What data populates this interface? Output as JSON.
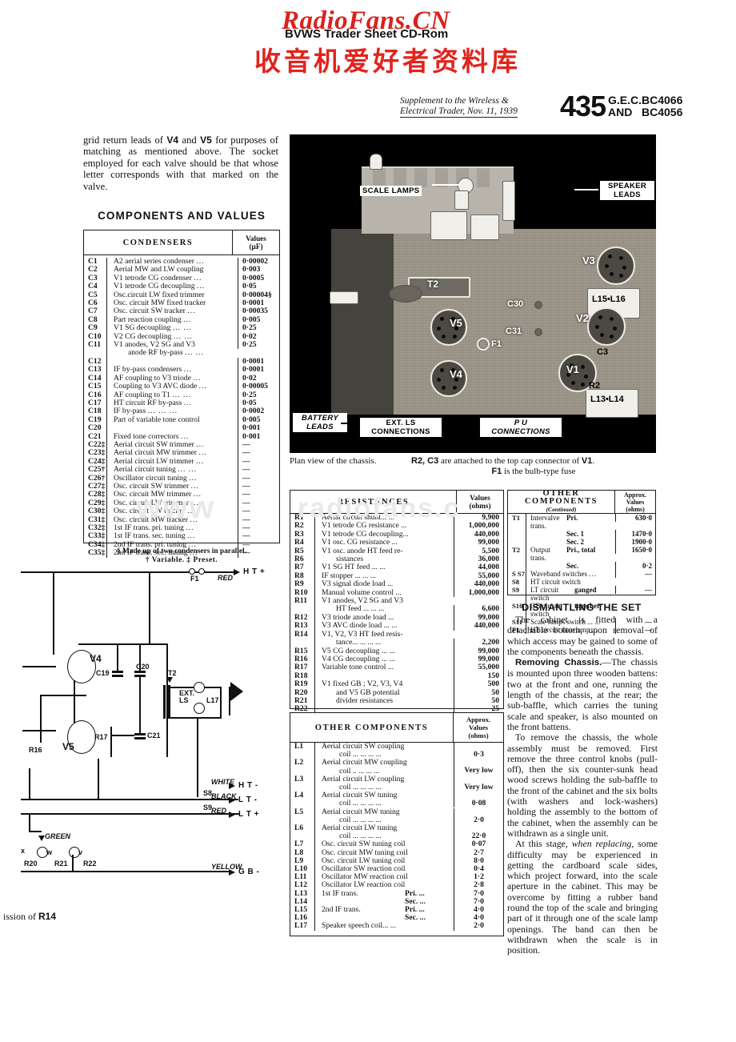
{
  "watermark": {
    "title": "RadioFans.CN",
    "subtitle": "BVWS Trader Sheet CD-Rom",
    "chinese": "收音机爱好者资料库",
    "faint_left": "www",
    "faint_mid": "radiofans.c",
    "accent": "#d8231e"
  },
  "masthead": {
    "supplement_line1": "Supplement to the Wireless &",
    "supplement_line2": "Electrical Trader, Nov. 11, 1939",
    "sheet_number": "435",
    "maker": "G.E.C.",
    "model_1": "BC4066",
    "and": "AND",
    "model_2": "BC4056"
  },
  "intro": {
    "paragraph": "grid return leads of <b>V4</b> and <b>V5</b> for purposes of matching as mentioned above. The socket employed for each valve should be that whose letter corresponds with that marked on the valve.",
    "section_title": "COMPONENTS AND VALUES"
  },
  "condensers": {
    "header": "CONDENSERS",
    "value_header_line1": "Values",
    "value_header_line2": "(µF)",
    "rows": [
      {
        "ref": "C1",
        "desc": "A2 aerial series condenser",
        "dots": "...",
        "val": "0·00002"
      },
      {
        "ref": "C2",
        "desc": "Aerial MW and LW coupling",
        "dots": "",
        "val": "0·003"
      },
      {
        "ref": "C3",
        "desc": "V1 tetrode CG condenser",
        "dots": "...",
        "val": "0·0005"
      },
      {
        "ref": "C4",
        "desc": "V1 tetrode CG decoupling",
        "dots": "...",
        "val": "0·05"
      },
      {
        "ref": "C5",
        "desc": "Osc.circuit LW fixed trimmer",
        "dots": "",
        "val": "0·00004§"
      },
      {
        "ref": "C6",
        "desc": "Osc. circuit MW fixed tracker",
        "dots": "",
        "val": "0·0001"
      },
      {
        "ref": "C7",
        "desc": "Osc. circuit SW tracker",
        "dots": "...",
        "val": "0·00035"
      },
      {
        "ref": "C8",
        "desc": "Part reaction coupling",
        "dots": "...",
        "val": "0·005"
      },
      {
        "ref": "C9",
        "desc": "V1 SG decoupling",
        "dots": "...   ...",
        "val": "0·25"
      },
      {
        "ref": "C10",
        "desc": "V2 CG decoupling",
        "dots": "...   ...",
        "val": "0·02"
      },
      {
        "ref": "C11",
        "desc": "V1 anodes, V2 SG and V3",
        "dots": "",
        "val": "0·25"
      },
      {
        "ref": "",
        "desc": "anode RF by-pass",
        "dots": "...   ...",
        "val": "",
        "cont": true,
        "indent": true
      },
      {
        "ref": "C12",
        "desc": "",
        "dots": "",
        "val": "0·0001"
      },
      {
        "ref": "C13",
        "desc": "IF by-pass condensers",
        "dots": "...",
        "val": "0·0001",
        "brace": true
      },
      {
        "ref": "C14",
        "desc": "AF coupling to V3 triode",
        "dots": "...",
        "val": "0·02"
      },
      {
        "ref": "C15",
        "desc": "Coupling to V3 AVC diode",
        "dots": "...",
        "val": "0·00005"
      },
      {
        "ref": "C16",
        "desc": "AF coupling to T1",
        "dots": "...   ...",
        "val": "0·25"
      },
      {
        "ref": "C17",
        "desc": "HT circuit RF by-pass",
        "dots": "...",
        "val": "0·05"
      },
      {
        "ref": "C18",
        "desc": "IF by-pass",
        "dots": "...    ...    ...",
        "val": "0·0002"
      },
      {
        "ref": "C19",
        "desc": "Part of variable tone control",
        "dots": "",
        "val": "0·005"
      },
      {
        "ref": "C20",
        "desc": "",
        "dots": "",
        "val": "0·001"
      },
      {
        "ref": "C21",
        "desc": "Fixed tone correctors",
        "dots": "...",
        "val": "0·001",
        "brace": true
      },
      {
        "ref": "C22‡",
        "desc": "Aerial circuit SW trimmer",
        "dots": "...",
        "val": "—"
      },
      {
        "ref": "C23‡",
        "desc": "Aerial circuit MW trimmer",
        "dots": "...",
        "val": "—"
      },
      {
        "ref": "C24‡",
        "desc": "Aerial circuit LW trimmer",
        "dots": "...",
        "val": "—"
      },
      {
        "ref": "C25†",
        "desc": "Aerial circuit tuning",
        "dots": "...   ...",
        "val": "—"
      },
      {
        "ref": "C26†",
        "desc": "Oscillator circuit tuning",
        "dots": "...",
        "val": "—"
      },
      {
        "ref": "C27‡",
        "desc": "Osc. circuit SW trimmer",
        "dots": "...",
        "val": "—"
      },
      {
        "ref": "C28‡",
        "desc": "Osc. circuit MW trimmer",
        "dots": "...",
        "val": "—"
      },
      {
        "ref": "C29‡",
        "desc": "Osc. circuit LW trimmer",
        "dots": "...",
        "val": "—"
      },
      {
        "ref": "C30‡",
        "desc": "Osc. circuit LW tracker",
        "dots": "...",
        "val": "—"
      },
      {
        "ref": "C31‡",
        "desc": "Osc. circuit MW tracker",
        "dots": "...",
        "val": "—"
      },
      {
        "ref": "C32‡",
        "desc": "1st IF trans. pri. tuning",
        "dots": "...",
        "val": "—"
      },
      {
        "ref": "C33‡",
        "desc": "1st IF trans. sec. tuning",
        "dots": "...",
        "val": "—"
      },
      {
        "ref": "C34‡",
        "desc": "2nd IF trans. pri. tuning",
        "dots": "...",
        "val": "—"
      },
      {
        "ref": "C35‡",
        "desc": "2nd IF trans. sec. tuning",
        "dots": "...",
        "val": "—"
      }
    ],
    "footnote_line1": "§ Made up of two condensers in parallel.",
    "footnote_line2": "† Variable.      ‡ Preset."
  },
  "resistances": {
    "header": "RESISTANCES",
    "value_header_line1": "Values",
    "value_header_line2": "(ohms)",
    "rows": [
      {
        "ref": "R1",
        "desc": "Aerial circuit shunt...      ...",
        "val": "9,900"
      },
      {
        "ref": "R2",
        "desc": "V1 tetrode CG resistance ...",
        "val": "1,000,000"
      },
      {
        "ref": "R3",
        "desc": "V1 tetrode CG decoupling...",
        "val": "440,000"
      },
      {
        "ref": "R4",
        "desc": "V1 osc. CG resistance      ...",
        "val": "99,000"
      },
      {
        "ref": "R5",
        "desc": "V1 osc. anode HT feed re-",
        "val": "5,500"
      },
      {
        "ref": "R6",
        "desc": "sistances",
        "val": "36,000",
        "indent": true,
        "brace": true
      },
      {
        "ref": "R7",
        "desc": "V1 SG HT feed      ...      ...",
        "val": "44,000"
      },
      {
        "ref": "R8",
        "desc": "IF stopper   ...     ...     ...",
        "val": "55,000"
      },
      {
        "ref": "R9",
        "desc": "V3 signal diode load       ...",
        "val": "440,000"
      },
      {
        "ref": "R10",
        "desc": "Manual volume control  ...",
        "val": "1,000,000"
      },
      {
        "ref": "R11",
        "desc": "V1 anodes, V2 SG and V3",
        "val": ""
      },
      {
        "ref": "",
        "desc": "HT feed   ...     ...     ...",
        "val": "6,600",
        "cont": true,
        "indent": true
      },
      {
        "ref": "R12",
        "desc": "V3 triode anode load       ...",
        "val": "99,000"
      },
      {
        "ref": "R13",
        "desc": "V3 AVC diode load ...      ...",
        "val": "440,000"
      },
      {
        "ref": "R14",
        "desc": "V1, V2, V3 HT feed resis-",
        "val": ""
      },
      {
        "ref": "",
        "desc": "tance...     ...      ...      ...",
        "val": "2,200",
        "cont": true,
        "indent": true
      },
      {
        "ref": "R15",
        "desc": "V5 CG decoupling   ...     ...",
        "val": "99,000"
      },
      {
        "ref": "R16",
        "desc": "V4 CG decoupling   ...     ...",
        "val": "99,000"
      },
      {
        "ref": "R17",
        "desc": "Variable tone control      ...",
        "val": "55,000"
      },
      {
        "ref": "R18",
        "desc": "",
        "val": "150"
      },
      {
        "ref": "R19",
        "desc": "V1 fixed GB ; V2, V3, V4",
        "val": "500"
      },
      {
        "ref": "R20",
        "desc": "and V5 GB potential",
        "val": "50",
        "indent": true
      },
      {
        "ref": "R21",
        "desc": "divider resistances",
        "val": "50",
        "indent": true
      },
      {
        "ref": "R22",
        "desc": "",
        "val": "25"
      }
    ]
  },
  "other_components": {
    "header": "OTHER COMPONENTS",
    "value_header_line1": "Approx.",
    "value_header_line2": "Values",
    "value_header_line3": "(ohms)",
    "rows": [
      {
        "ref": "L1",
        "desc": "Aerial circuit SW coupling",
        "desc2": "coil    ...      ...      ...      ...",
        "val": "0·3"
      },
      {
        "ref": "L2",
        "desc": "Aerial circuit MW coupling",
        "desc2": "coil   ..      ...      ...      ...",
        "val": "Very low"
      },
      {
        "ref": "L3",
        "desc": "Aerial circuit LW coupling",
        "desc2": "coil    ...      ...      ...      ...",
        "val": "Very low"
      },
      {
        "ref": "L4",
        "desc": "Aerial circuit  SW  tuning",
        "desc2": "coil    ...      ...      ...      ...",
        "val": "0·08"
      },
      {
        "ref": "L5",
        "desc": "Aerial  circuit  MW  tuning",
        "desc2": "coil    ...      ...      ...      ...",
        "val": "2·0"
      },
      {
        "ref": "L6",
        "desc": "Aerial  circuit  LW  tuning",
        "desc2": "coil    ...      ...      ...      ...",
        "val": "22·0"
      },
      {
        "ref": "L7",
        "desc": "Osc. circuit SW tuning coil",
        "val": "0·07"
      },
      {
        "ref": "L8",
        "desc": "Osc. circuit MW tuning coil",
        "val": "2·7"
      },
      {
        "ref": "L9",
        "desc": "Osc. circuit LW tuning coil",
        "val": "8·0"
      },
      {
        "ref": "L10",
        "desc": "Oscillator SW reaction coil",
        "val": "0·4"
      },
      {
        "ref": "L11",
        "desc": "Oscillator MW reaction coil",
        "val": "1·2"
      },
      {
        "ref": "L12",
        "desc": "Oscillator LW reaction coil",
        "val": "2·8"
      },
      {
        "ref": "L13",
        "desc": "1st IF trans.",
        "sub": "Pri.        ...",
        "val": "7·0",
        "grouped": true
      },
      {
        "ref": "L14",
        "desc": "",
        "sub": "Sec.       ...",
        "val": "7·0",
        "grouped": true
      },
      {
        "ref": "L15",
        "desc": "2nd IF trans.",
        "sub": "Pri.        ...",
        "val": "4·0",
        "grouped": true
      },
      {
        "ref": "L16",
        "desc": "",
        "sub": "Sec.       ...",
        "val": "4·0",
        "grouped": true
      },
      {
        "ref": "L17",
        "desc": "Speaker speech coil...      ...",
        "val": "2·0"
      }
    ]
  },
  "other_components_continued": {
    "header": "OTHER COMPONENTS",
    "header_sub": "(Continued)",
    "value_header_line1": "Approx.",
    "value_header_line2": "Values",
    "value_header_line3": "(ohms)",
    "rows": [
      {
        "ref": "T1",
        "desc": "Intervalve trans.",
        "sub": "Pri.",
        "val": "630·0"
      },
      {
        "ref": "",
        "desc": "",
        "sub": "Sec. 1",
        "val": "1470·0"
      },
      {
        "ref": "",
        "desc": "",
        "sub": "Sec. 2",
        "val": "1900·0"
      },
      {
        "ref": "T2",
        "desc": "Output trans.",
        "sub": "Pri., total",
        "val": "1650·0"
      },
      {
        "ref": "",
        "desc": "",
        "sub": "Sec.",
        "val": "0·2"
      },
      {
        "ref": "S  S7",
        "desc": "Waveband switches",
        "dots": "...",
        "val": "—"
      },
      {
        "ref": "S8",
        "desc": "HT circuit switch",
        "val": ""
      },
      {
        "ref": "S9",
        "desc": "LT circuit switch",
        "val": "—",
        "note": "ganged"
      },
      {
        "ref": "S10",
        "desc": "GB circuit switch",
        "val": "",
        "note": "together"
      },
      {
        "ref": "S11",
        "desc": "Scale lamps switch ...   ...",
        "val": "—"
      },
      {
        "ref": "F1",
        "desc": "HT circuit fuse lamp      ...",
        "val": "—"
      }
    ]
  },
  "photo": {
    "labels": {
      "scale_lamps": "SCALE LAMPS",
      "speaker_leads_l1": "SPEAKER",
      "speaker_leads_l2": "LEADS",
      "battery_leads_l1": "BATTERY",
      "battery_leads_l2": "LEADS",
      "ext_ls_l1": "EXT. LS",
      "ext_ls_l2": "CONNECTIONS",
      "pu_l1": "P U",
      "pu_l2": "CONNECTIONS"
    },
    "callouts": [
      "T2",
      "V3",
      "L15 • L16",
      "V5",
      "F1",
      "C30",
      "C31",
      "V2",
      "C3",
      "V4",
      "V1",
      "L13 • L14",
      "R2"
    ]
  },
  "caption": {
    "left": "Plan view of the chassis.",
    "right_line1": "<b>R2, C3</b> are attached to the top cap connector of <b>V1</b>.",
    "right_line2": "<b>F1</b> is the bulb-type fuse"
  },
  "dismantling": {
    "heading": "DISMANTLING THE SET",
    "p1": "The cabinet is fitted with a detachable bottom, upon removal of which access may be gained to some of the components beneath the chassis.",
    "p2_lead": "Removing Chassis.",
    "p2": "—The chassis is mounted upon three wooden battens: two at the front and one, running the length of the chassis, at the rear; the sub-baffle, which carries the tuning scale and speaker, is also mounted on the front battens.",
    "p3": "To remove the chassis, the whole assembly must be removed. First remove the three control knobs (pull-off), then the six counter-sunk head wood screws holding the sub-baffle to the front of the cabinet and the six bolts (with washers and lock-washers) holding the assembly to the bottom of the cabinet, when the assembly can be withdrawn as a single unit.",
    "p4_pre": "At this stage, ",
    "p4_italic": "when replacing,",
    "p4": " some difficulty may be experienced in getting the cardboard scale sides, which project forward, into the scale aperture in the cabinet. This may be overcome by fitting a rubber band round the top of the scale and bringing part of it through one of the scale lamp openings. The band can then be withdrawn when the scale is in position."
  },
  "circuit": {
    "terminals": {
      "ht_plus": "H T +",
      "ht_minus": "H T -",
      "lt_minus": "L T -",
      "lt_plus": "L T +",
      "gb_minus": "G B -"
    },
    "wire_colours": {
      "red_top": "RED",
      "white": "WHITE",
      "black": "BLACK",
      "red": "RED",
      "green": "GREEN",
      "yellow": "YELLOW"
    },
    "components": {
      "f1": "F1",
      "v4": "V4",
      "v5": "V5",
      "c19": "C19",
      "c20": "C20",
      "c21": "C21",
      "r17": "R17",
      "r16": "R16",
      "r20": "R20",
      "r21": "R21",
      "r22": "R22",
      "t2": "T2",
      "l17": "L17",
      "ext_ls_l1": "EXT.",
      "ext_ls_l2": "LS",
      "s8": "S8",
      "s9": "S9",
      "tap_x": "x",
      "tap_w": "w",
      "tap_v": "v"
    },
    "footer_note": "ission of R14"
  }
}
